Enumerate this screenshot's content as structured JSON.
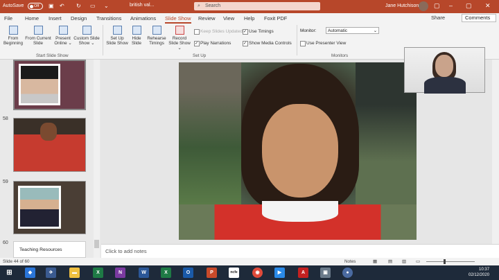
{
  "titlebar": {
    "autosave": "AutoSave",
    "toggle": "Off",
    "doc": "british val...",
    "search": "Search",
    "user": "Jane Hutchison"
  },
  "tabs": [
    "File",
    "Home",
    "Insert",
    "Design",
    "Transitions",
    "Animations",
    "Slide Show",
    "Review",
    "View",
    "Help",
    "Foxit PDF"
  ],
  "share": "Share",
  "comments": "Comments",
  "ribbon": {
    "from_beginning": "From Beginning",
    "from_current": "From Current Slide",
    "present_online": "Present Online ⌄",
    "custom_show": "Custom Slide Show ⌄",
    "group_start": "Start Slide Show",
    "setup_show": "Set Up Slide Show",
    "hide_slide": "Hide Slide",
    "rehearse": "Rehearse Timings",
    "record": "Record Slide Show ⌄",
    "keep_slides": "Keep Slides Updated",
    "play_narrations": "Play Narrations",
    "use_timings": "Use Timings",
    "show_media": "Show Media Controls",
    "group_setup": "Set Up",
    "monitor_label": "Monitor:",
    "monitor_value": "Automatic",
    "presenter_view": "Use Presenter View",
    "group_monitors": "Monitors"
  },
  "thumbnails": {
    "n58": "58",
    "n59": "59",
    "n60": "60",
    "teaching": "Teaching Resources"
  },
  "notes": "Click to add notes",
  "status": {
    "slide": "Slide 44 of 60",
    "notes": "Notes"
  },
  "tray": {
    "time": "10:37",
    "date": "02/12/2020"
  }
}
